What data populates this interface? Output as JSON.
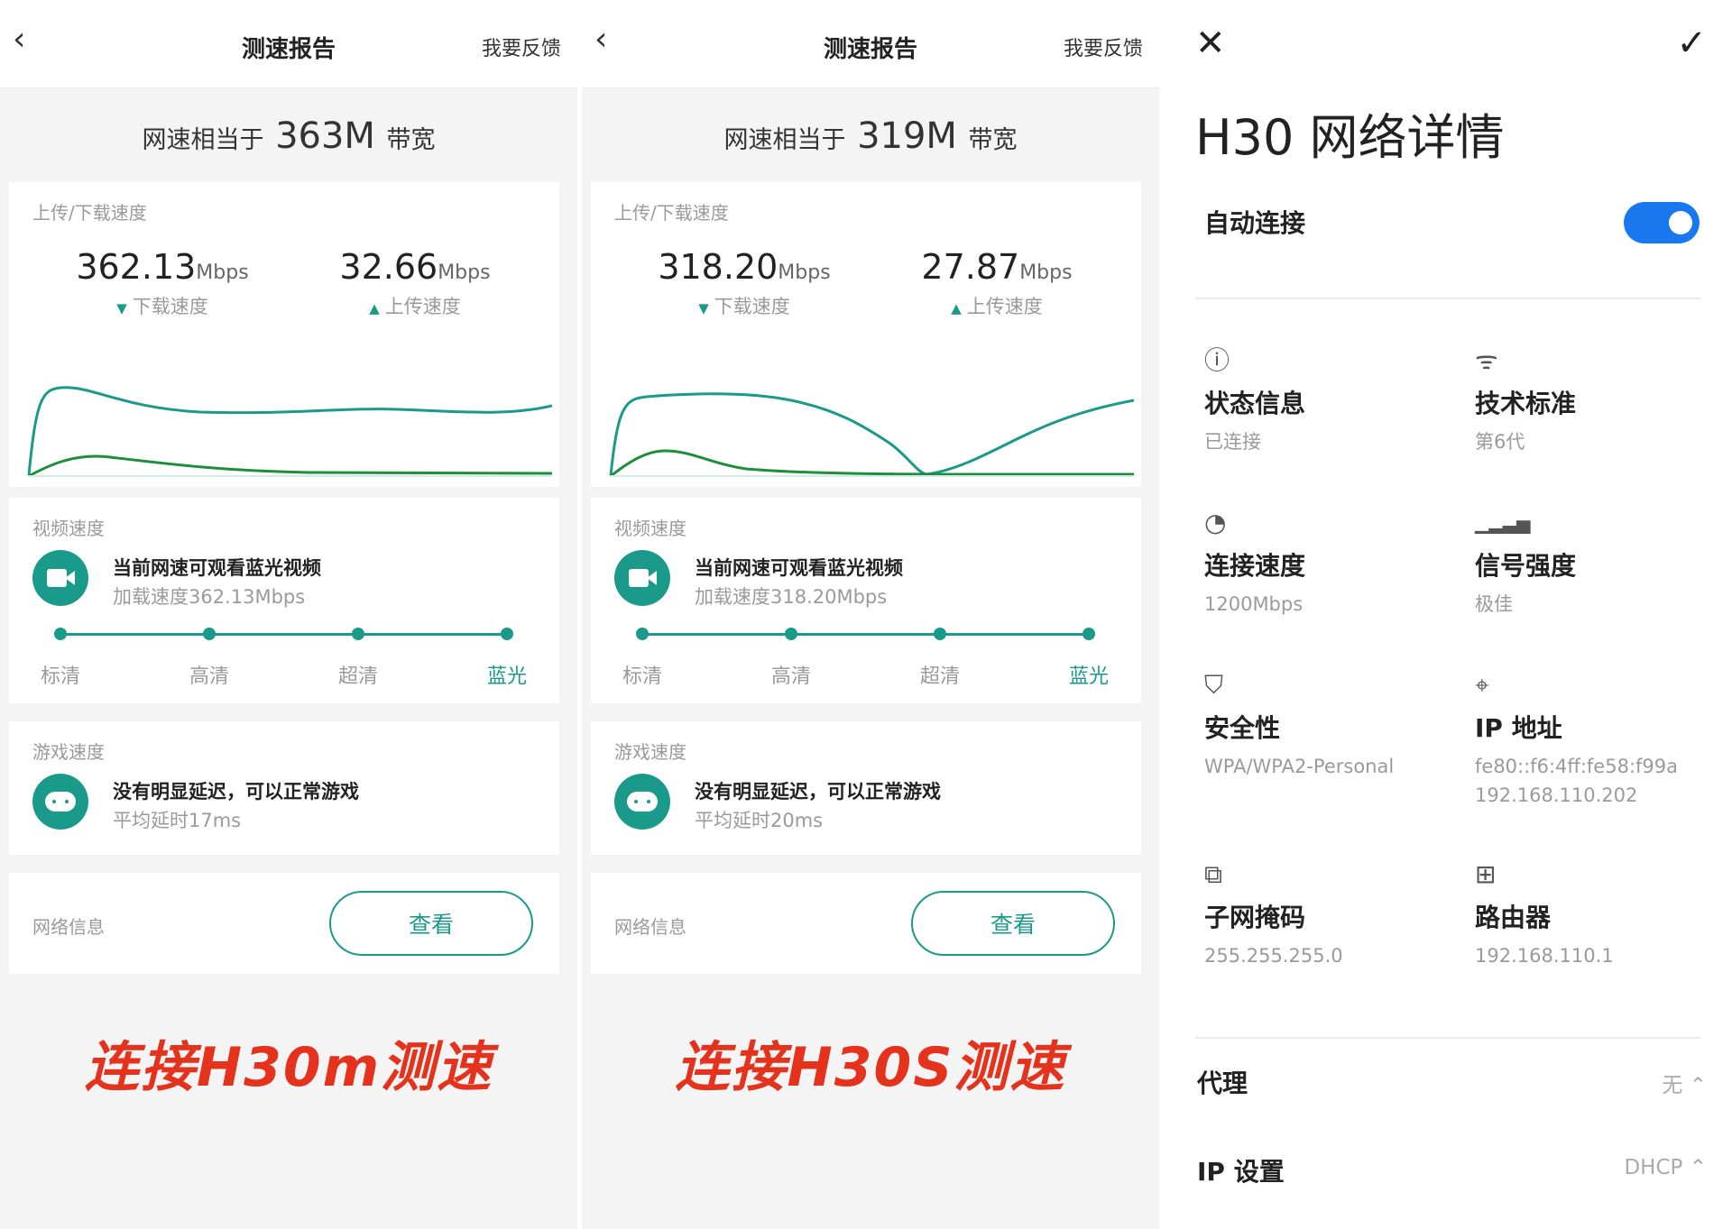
{
  "panels": [
    {
      "header": {
        "back": "‹",
        "title": "测速报告",
        "feedback": "我要反馈"
      },
      "summary": {
        "prefix": "网速相当于",
        "value": "363M",
        "suffix": "带宽"
      },
      "speed": {
        "label": "上传/下载速度",
        "download": {
          "value": "362.13",
          "unit": "Mbps",
          "caption": "下载速度"
        },
        "upload": {
          "value": "32.66",
          "unit": "Mbps",
          "caption": "上传速度"
        }
      },
      "video": {
        "label": "视频速度",
        "title": "当前网速可观看蓝光视频",
        "sub": "加载速度362.13Mbps",
        "levels": [
          "标清",
          "高清",
          "超清",
          "蓝光"
        ]
      },
      "game": {
        "label": "游戏速度",
        "title": "没有明显延迟，可以正常游戏",
        "sub": "平均延时17ms"
      },
      "network": {
        "label": "网络信息",
        "button": "查看"
      },
      "caption": "连接H30m测速"
    },
    {
      "header": {
        "back": "‹",
        "title": "测速报告",
        "feedback": "我要反馈"
      },
      "summary": {
        "prefix": "网速相当于",
        "value": "319M",
        "suffix": "带宽"
      },
      "speed": {
        "label": "上传/下载速度",
        "download": {
          "value": "318.20",
          "unit": "Mbps",
          "caption": "下载速度"
        },
        "upload": {
          "value": "27.87",
          "unit": "Mbps",
          "caption": "上传速度"
        }
      },
      "video": {
        "label": "视频速度",
        "title": "当前网速可观看蓝光视频",
        "sub": "加载速度318.20Mbps",
        "levels": [
          "标清",
          "高清",
          "超清",
          "蓝光"
        ]
      },
      "game": {
        "label": "游戏速度",
        "title": "没有明显延迟，可以正常游戏",
        "sub": "平均延时20ms"
      },
      "network": {
        "label": "网络信息",
        "button": "查看"
      },
      "caption": "连接H30S测速"
    }
  ],
  "details": {
    "close": "✕",
    "confirm": "✓",
    "title": "H30 网络详情",
    "auto_connect": {
      "label": "自动连接",
      "on": true
    },
    "items": [
      {
        "icon": "ⓘ",
        "title": "状态信息",
        "values": [
          "已连接"
        ]
      },
      {
        "icon": "ᯤ",
        "title": "技术标准",
        "values": [
          "第6代"
        ]
      },
      {
        "icon": "◔",
        "title": "连接速度",
        "values": [
          "1200Mbps"
        ]
      },
      {
        "icon": "▁▂▃▅",
        "title": "信号强度",
        "values": [
          "极佳"
        ]
      },
      {
        "icon": "⛉",
        "title": "安全性",
        "values": [
          "WPA/WPA2-Personal"
        ]
      },
      {
        "icon": "⌖",
        "title": "IP 地址",
        "values": [
          "fe80::f6:4ff:fe58:f99a",
          "192.168.110.202"
        ]
      },
      {
        "icon": "⧉",
        "title": "子网掩码",
        "values": [
          "255.255.255.0"
        ]
      },
      {
        "icon": "⊞",
        "title": "路由器",
        "values": [
          "192.168.110.1"
        ]
      }
    ],
    "proxy": {
      "label": "代理",
      "value": "无 ⌃"
    },
    "ip_setting": {
      "label": "IP 设置",
      "value": "DHCP ⌃"
    }
  },
  "colors": {
    "accent": "#1a9a8a",
    "download_line": "#1a9a8a",
    "upload_line": "#1d8f3a",
    "toggle": "#1a78ee",
    "caption": "#e5321d"
  }
}
